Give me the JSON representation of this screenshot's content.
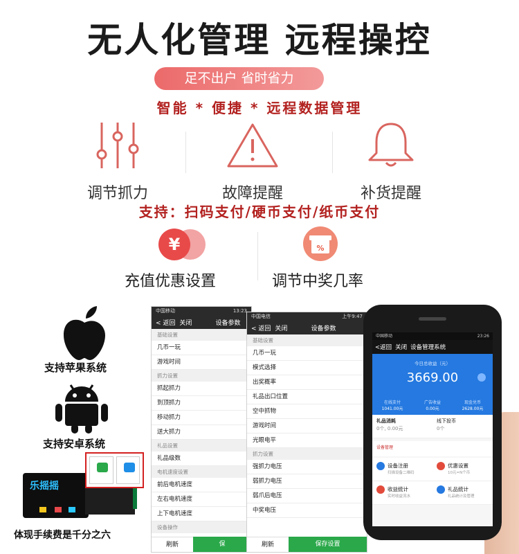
{
  "headline": "无人化管理  远程操控",
  "tagline": "足不出户  省时省力",
  "features": "智能 * 便捷 * 远程数据管理",
  "icons": [
    {
      "icon": "sliders-icon",
      "label": "调节抓力"
    },
    {
      "icon": "warning-icon",
      "label": "故障提醒"
    },
    {
      "icon": "bell-icon",
      "label": "补货提醒"
    }
  ],
  "payment_text": "支持：扫码支付/硬币支付/纸币支付",
  "options": [
    {
      "icon": "yen-coupon-icon",
      "label": "充值优惠设置"
    },
    {
      "icon": "gift-percent-icon",
      "label": "调节中奖几率"
    }
  ],
  "os": {
    "apple": "支持苹果系统",
    "android": "支持安卓系统"
  },
  "fee_text": "体现手续费是千分之六",
  "phone1": {
    "status_left": "中国移动",
    "status_time": "13:23",
    "back": "返回",
    "close": "关闭",
    "title": "设备参数",
    "sections": [
      {
        "header": "基础设置",
        "rows": [
          "几币一玩",
          "游戏时间"
        ]
      },
      {
        "header": "抓力设置",
        "rows": [
          "抓起抓力",
          "到顶抓力",
          "移动抓力",
          "送大抓力"
        ]
      },
      {
        "header": "礼品设置",
        "rows": [
          "礼品级数"
        ]
      },
      {
        "header": "电机速度设置",
        "rows": [
          "前后电机速度",
          "左右电机速度",
          "上下电机速度"
        ]
      },
      {
        "header": "设备操作",
        "rows": []
      }
    ],
    "btn_refresh": "刷新",
    "btn_save": "保"
  },
  "phone2": {
    "status_left": "中国电信",
    "status_time": "上午9:47",
    "back": "返回",
    "close": "关闭",
    "title": "设备参数",
    "sections": [
      {
        "header": "基础设置",
        "rows": [
          "几币一玩",
          "模式选择",
          "出奖概率",
          "礼品出口位置",
          "空中抓物",
          "游戏时间",
          "光眼电平"
        ]
      },
      {
        "header": "抓力设置",
        "rows": [
          "强抓力电压",
          "弱抓力电压",
          "弱爪后电压",
          "中奖电压"
        ]
      }
    ],
    "btn_refresh": "刷新",
    "btn_save": "保存设置"
  },
  "phone3": {
    "status_left": "中国移动",
    "status_time": "23:26",
    "back": "返回",
    "close": "关闭",
    "title": "设备管理系统",
    "today_label": "今日总收益（元）",
    "today_value": "3669.00",
    "stats": [
      {
        "label": "在线支付",
        "value": "1041.00元"
      },
      {
        "label": "广告收益",
        "value": "0.00元"
      },
      {
        "label": "现金兑币",
        "value": "2628.00元"
      }
    ],
    "gift_consume_label": "礼品消耗",
    "gift_consume_value": "0个, 0.00元",
    "offline_label": "线下投币",
    "offline_value": "0个",
    "notice": "设备管理",
    "grid": [
      {
        "label": "设备注册",
        "sub": "扫描设备二维码",
        "color": "#2579e0"
      },
      {
        "label": "优惠设置",
        "sub": "10元=N个币",
        "color": "#e24b3b"
      },
      {
        "label": "收益统计",
        "sub": "实时收益流水",
        "color": "#e24b3b"
      },
      {
        "label": "礼品统计",
        "sub": "礼品统计及管理",
        "color": "#2579e0"
      }
    ]
  },
  "colors": {
    "accent_red": "#b2211f",
    "pill": "#ec6a6a",
    "green": "#2aa84a",
    "blue": "#2579e0"
  }
}
